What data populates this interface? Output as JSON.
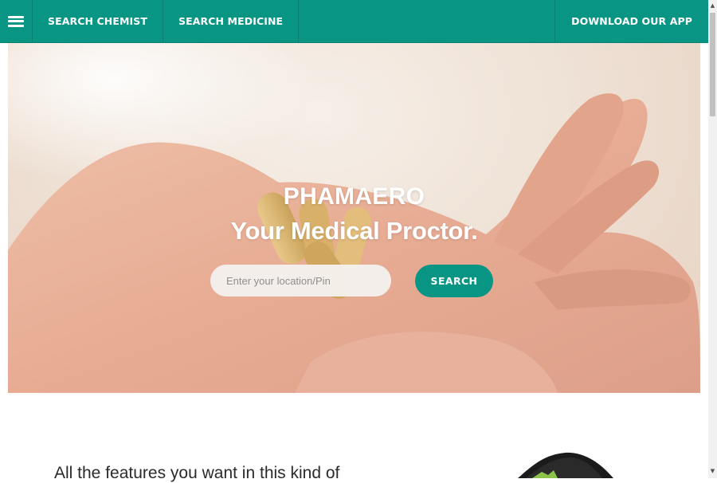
{
  "navbar": {
    "menu_icon": "hamburger-menu-icon",
    "links": [
      "SEARCH CHEMIST",
      "SEARCH MEDICINE"
    ],
    "download_label": "DOWNLOAD OUR APP",
    "color": "#099584"
  },
  "hero": {
    "title": "PHAMAERO",
    "tagline": "Your Medical Proctor.",
    "search": {
      "placeholder": "Enter your location/Pin",
      "value": "",
      "button_label": "SEARCH"
    }
  },
  "features": {
    "heading": "All the features you want in this kind of"
  }
}
